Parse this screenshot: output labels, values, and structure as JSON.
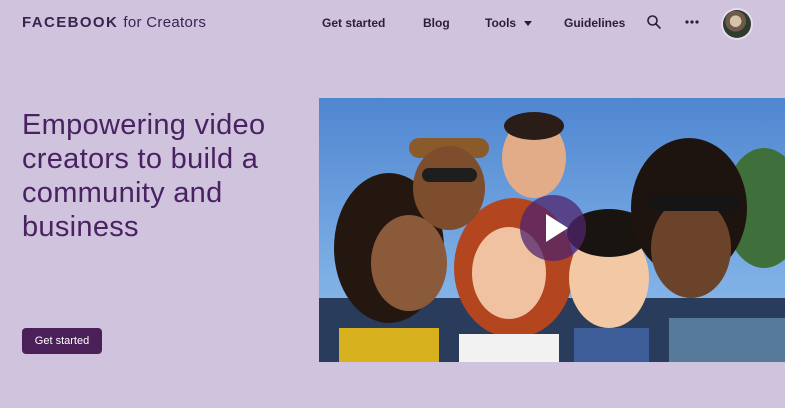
{
  "header": {
    "brand_bold": "FACEBOOK",
    "brand_light": "for Creators",
    "nav": {
      "get_started": "Get started",
      "blog": "Blog",
      "tools": "Tools",
      "guidelines": "Guidelines"
    },
    "icons": {
      "search": "search-icon",
      "more": "more-icon"
    }
  },
  "hero": {
    "title": "Empowering video creators to build a community and business",
    "cta": "Get started"
  },
  "colors": {
    "background": "#cfc3dd",
    "accent": "#4b1f57",
    "heading": "#4a2261"
  }
}
